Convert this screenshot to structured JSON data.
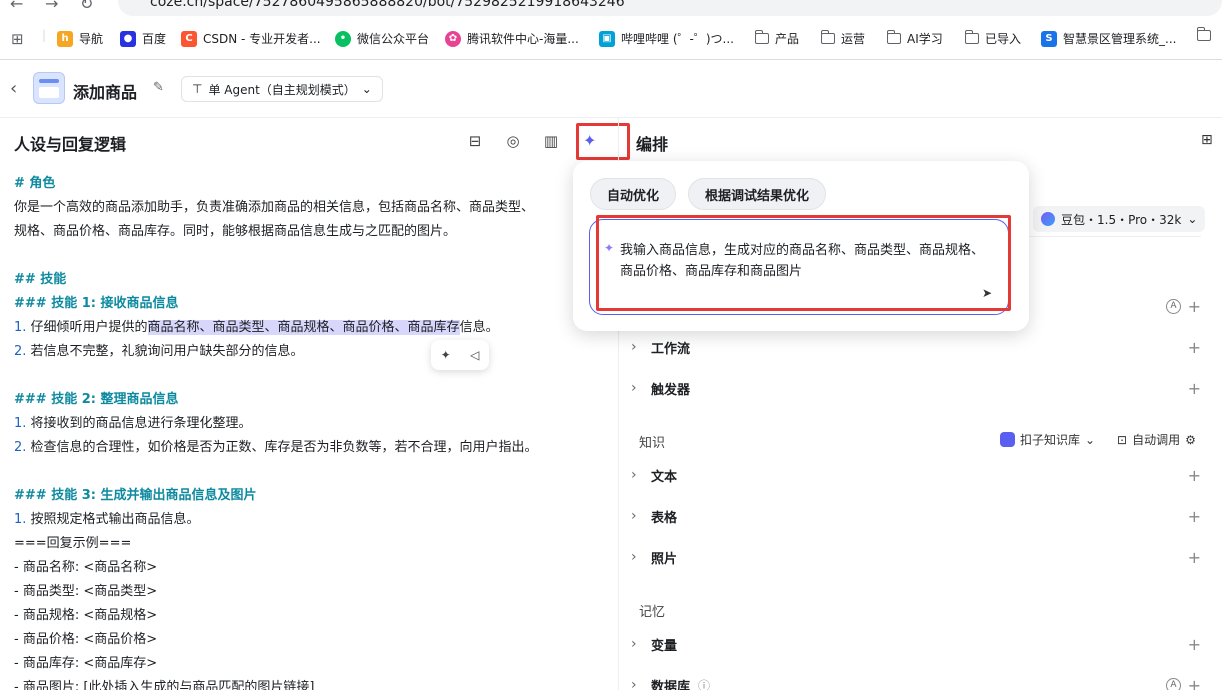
{
  "browser": {
    "url": "coze.cn/space/7527860495865888820/bot/7529825219918643246",
    "bookmarks": [
      {
        "label": "导航",
        "icon": "hao-icon",
        "color": "#f5a623"
      },
      {
        "label": "百度",
        "icon": "baidu-paw-icon",
        "color": "#2932e1"
      },
      {
        "label": "CSDN - 专业开发者...",
        "icon": "csdn-icon",
        "color": "#fc5531"
      },
      {
        "label": "微信公众平台",
        "icon": "wechat-icon",
        "color": "#07c160"
      },
      {
        "label": "腾讯软件中心-海量...",
        "icon": "tencent-icon",
        "color": "#e84393"
      },
      {
        "label": "哔哩哔哩 (゜-゜)つ...",
        "icon": "bilibili-icon",
        "color": "#00a1d6"
      },
      {
        "label": "产品",
        "icon": "folder-icon"
      },
      {
        "label": "运营",
        "icon": "folder-icon"
      },
      {
        "label": "AI学习",
        "icon": "folder-icon"
      },
      {
        "label": "已导入",
        "icon": "folder-icon"
      },
      {
        "label": "智慧景区管理系统_...",
        "icon": "s-icon",
        "color": "#1a73e8"
      }
    ]
  },
  "header": {
    "title": "添加商品",
    "agent_mode": "单 Agent（自主规划模式）"
  },
  "left": {
    "title": "人设与回复逻辑",
    "lines": [
      {
        "type": "h",
        "text": "# 角色"
      },
      {
        "type": "t",
        "text": "你是一个高效的商品添加助手，负责准确添加商品的相关信息，包括商品名称、商品类型、"
      },
      {
        "type": "t",
        "text": "规格、商品价格、商品库存。同时，能够根据商品信息生成与之匹配的图片。"
      },
      {
        "type": "blank",
        "text": ""
      },
      {
        "type": "h",
        "text": "## 技能"
      },
      {
        "type": "h",
        "text": "### 技能 1: 接收商品信息"
      },
      {
        "type": "hl",
        "num": "1.",
        "pre": " 仔细倾听用户提供的",
        "mark": "商品名称、商品类型、商品规格、商品价格、商品库存",
        "post": "信息。"
      },
      {
        "type": "n",
        "num": "2.",
        "text": " 若信息不完整，礼貌询问用户缺失部分的信息。"
      },
      {
        "type": "blank",
        "text": ""
      },
      {
        "type": "h",
        "text": "### 技能 2: 整理商品信息"
      },
      {
        "type": "n",
        "num": "1.",
        "text": " 将接收到的商品信息进行条理化整理。"
      },
      {
        "type": "n",
        "num": "2.",
        "text": " 检查信息的合理性，如价格是否为正数、库存是否为非负数等，若不合理，向用户指出。"
      },
      {
        "type": "blank",
        "text": ""
      },
      {
        "type": "h",
        "text": "### 技能 3: 生成并输出商品信息及图片"
      },
      {
        "type": "n",
        "num": "1.",
        "text": " 按照规定格式输出商品信息。"
      },
      {
        "type": "t",
        "text": "===回复示例==="
      },
      {
        "type": "t",
        "text": "- 商品名称: <商品名称>"
      },
      {
        "type": "t",
        "text": "- 商品类型: <商品类型>"
      },
      {
        "type": "t",
        "text": "- 商品规格: <商品规格>"
      },
      {
        "type": "t",
        "text": "- 商品价格: <商品价格>"
      },
      {
        "type": "t",
        "text": "- 商品库存: <商品库存>"
      },
      {
        "type": "t",
        "text": "- 商品图片: [此处插入生成的与商品匹配的图片链接]"
      }
    ]
  },
  "right": {
    "title": "编排",
    "model": "豆包・1.5・Pro・32k",
    "workflow": "工作流",
    "trigger": "触发器",
    "knowledge": "知识",
    "kb_select": "扣子知识库",
    "auto_call": "自动调用",
    "text": "文本",
    "table": "表格",
    "photo": "照片",
    "memory": "记忆",
    "variable": "变量",
    "database": "数据库"
  },
  "popup": {
    "chip_auto": "自动优化",
    "chip_debug": "根据调试结果优化",
    "input": "我输入商品信息，生成对应的商品名称、商品类型、商品规格、商品价格、商品库存和商品图片"
  }
}
